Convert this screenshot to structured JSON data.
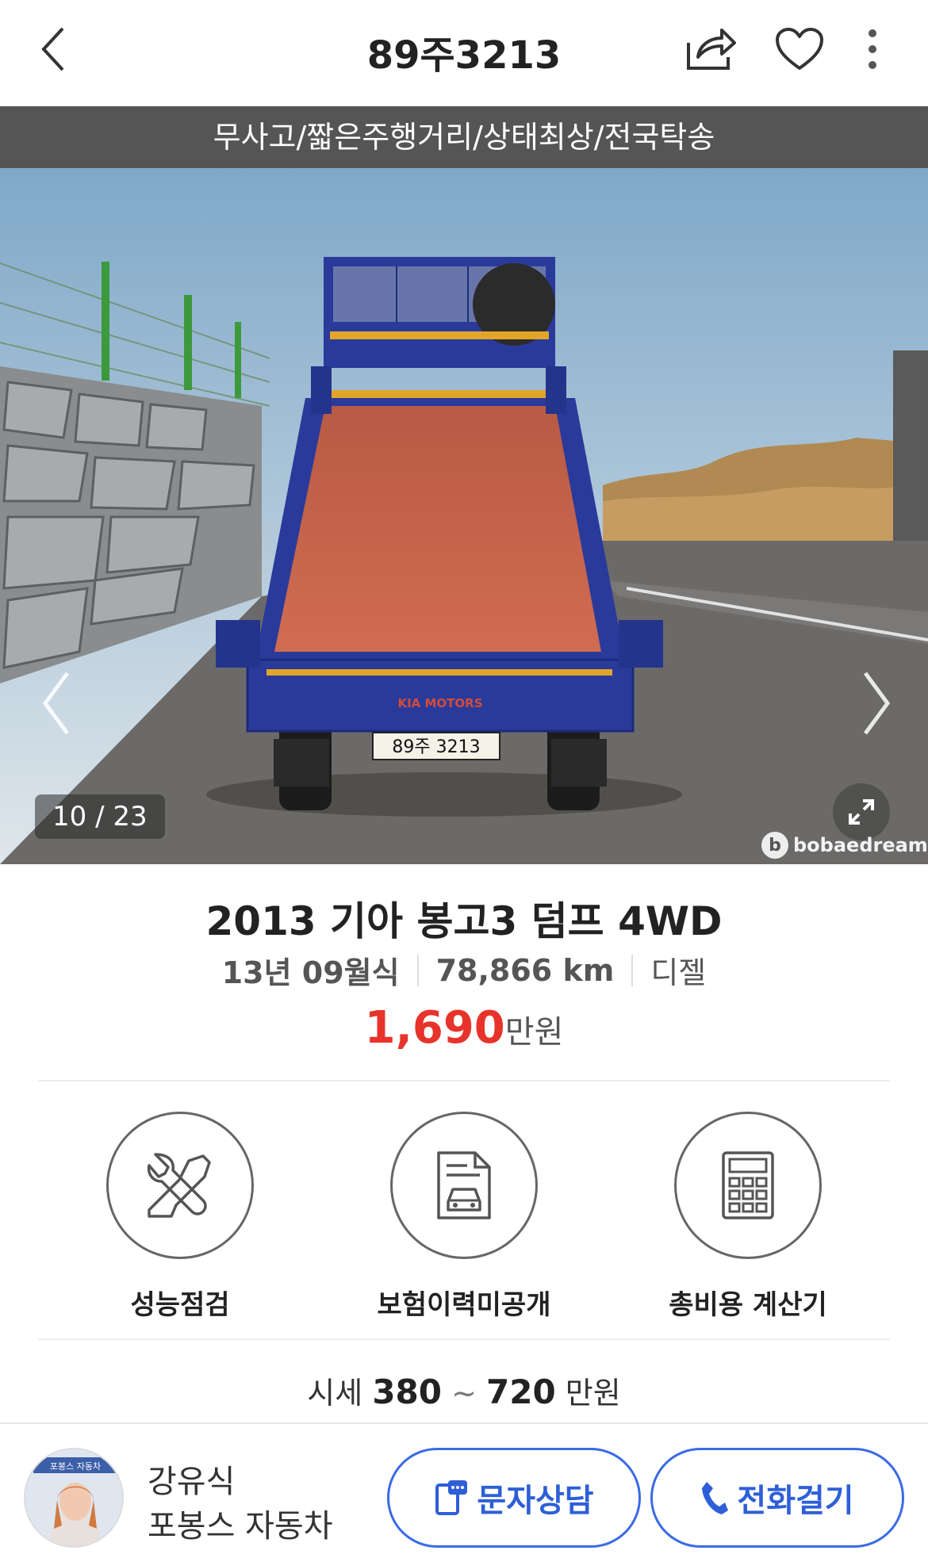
{
  "header": {
    "title": "89주3213",
    "back_icon": "chevron-left-icon",
    "share_icon": "share-icon",
    "favorite_icon": "heart-icon",
    "more_icon": "more-vertical-icon"
  },
  "banner": {
    "text": "무사고/짧은주행거리/상태최상/전국탁송"
  },
  "photo": {
    "counter": "10 / 23",
    "watermark": "bobaedream",
    "watermark_logo": "b",
    "truck_badge": "KIA MOTORS",
    "plate": "89주 3213"
  },
  "car": {
    "name": "2013 기아 봉고3 덤프 4WD",
    "year": "13년 09월식",
    "mileage": "78,866 km",
    "fuel": "디젤",
    "price": "1,690",
    "price_unit": "만원"
  },
  "features": [
    {
      "label": "성능점검",
      "icon": "tools-icon"
    },
    {
      "label": "보험이력미공개",
      "icon": "insurance-document-icon"
    },
    {
      "label": "총비용 계산기",
      "icon": "calculator-icon"
    }
  ],
  "market": {
    "prefix": "시세",
    "min": "380",
    "tilde": "~",
    "max": "720",
    "unit": "만원"
  },
  "dealer": {
    "name": "강유식",
    "company": "포봉스 자동차",
    "avatar_caption": "포봉스 자동차"
  },
  "actions": {
    "sms_label": "문자상담",
    "call_label": "전화걸기"
  },
  "colors": {
    "price_red": "#e8332b",
    "action_blue": "#2e5fd8",
    "banner_gray": "#555555",
    "truck_blue": "#2a3a9a",
    "truck_bed": "#c9624a"
  }
}
